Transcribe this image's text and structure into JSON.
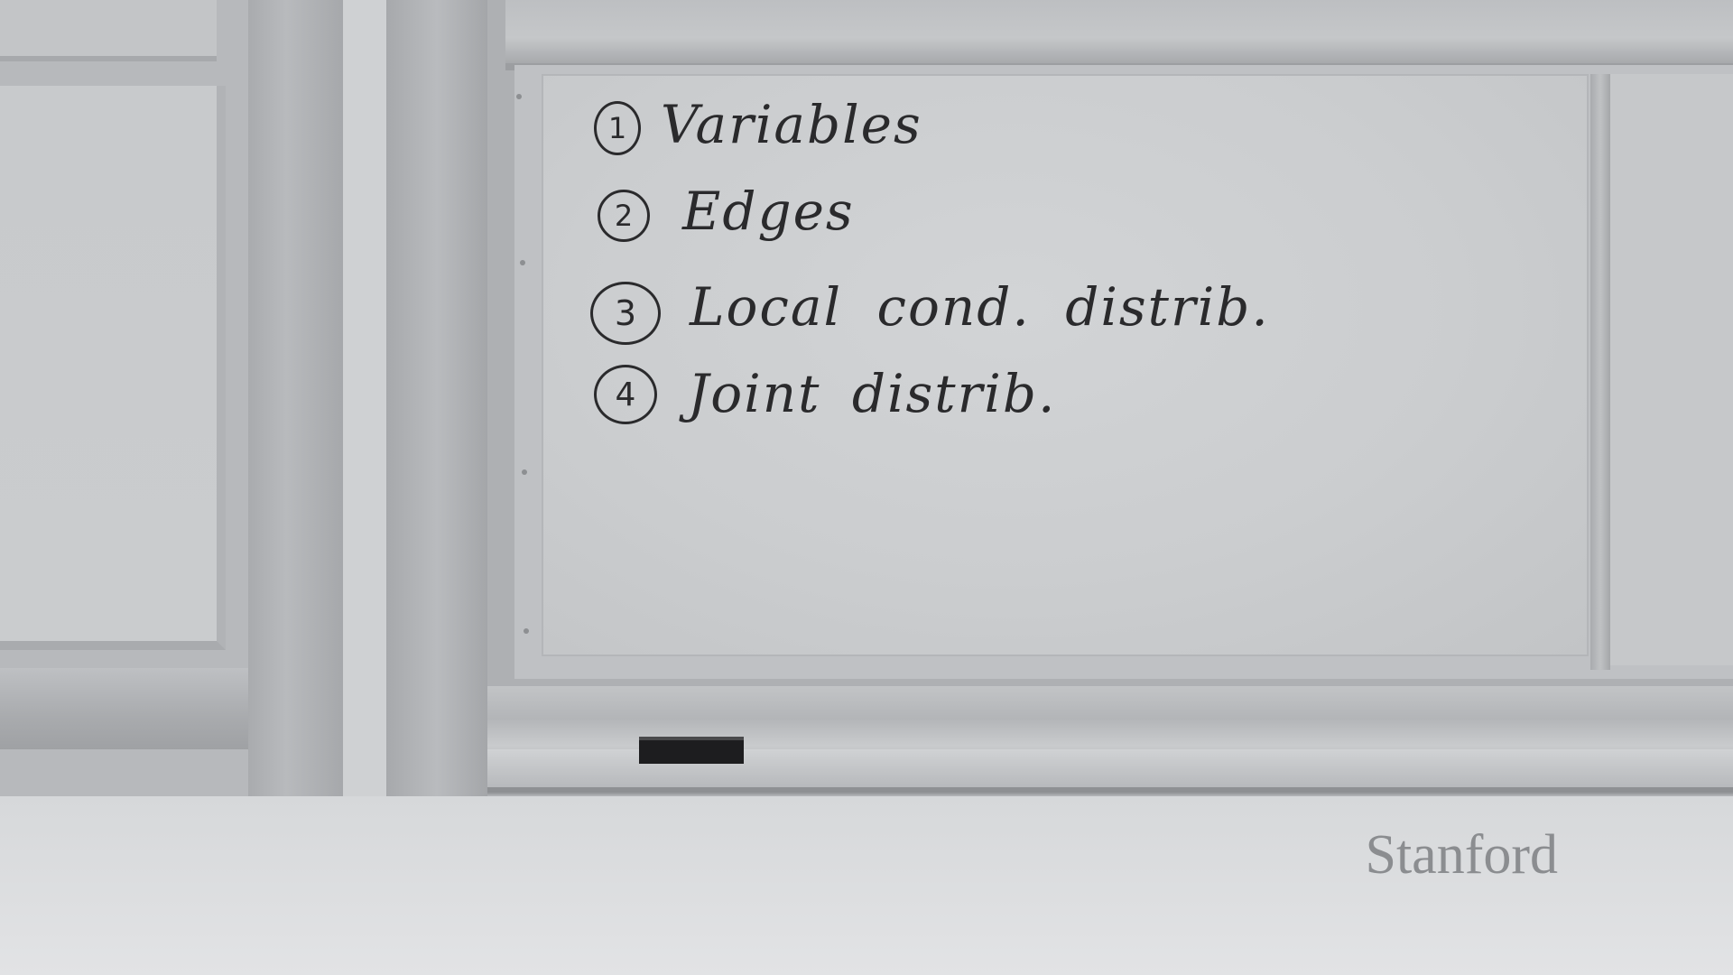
{
  "scene": "classroom whiteboard",
  "whiteboard": {
    "items": [
      {
        "number": "1",
        "text": "Variables"
      },
      {
        "number": "2",
        "text": "Edges"
      },
      {
        "number": "3",
        "text": "Local cond. distrib."
      },
      {
        "number": "4",
        "text": "Joint distrib."
      }
    ]
  },
  "watermark": "Stanford"
}
